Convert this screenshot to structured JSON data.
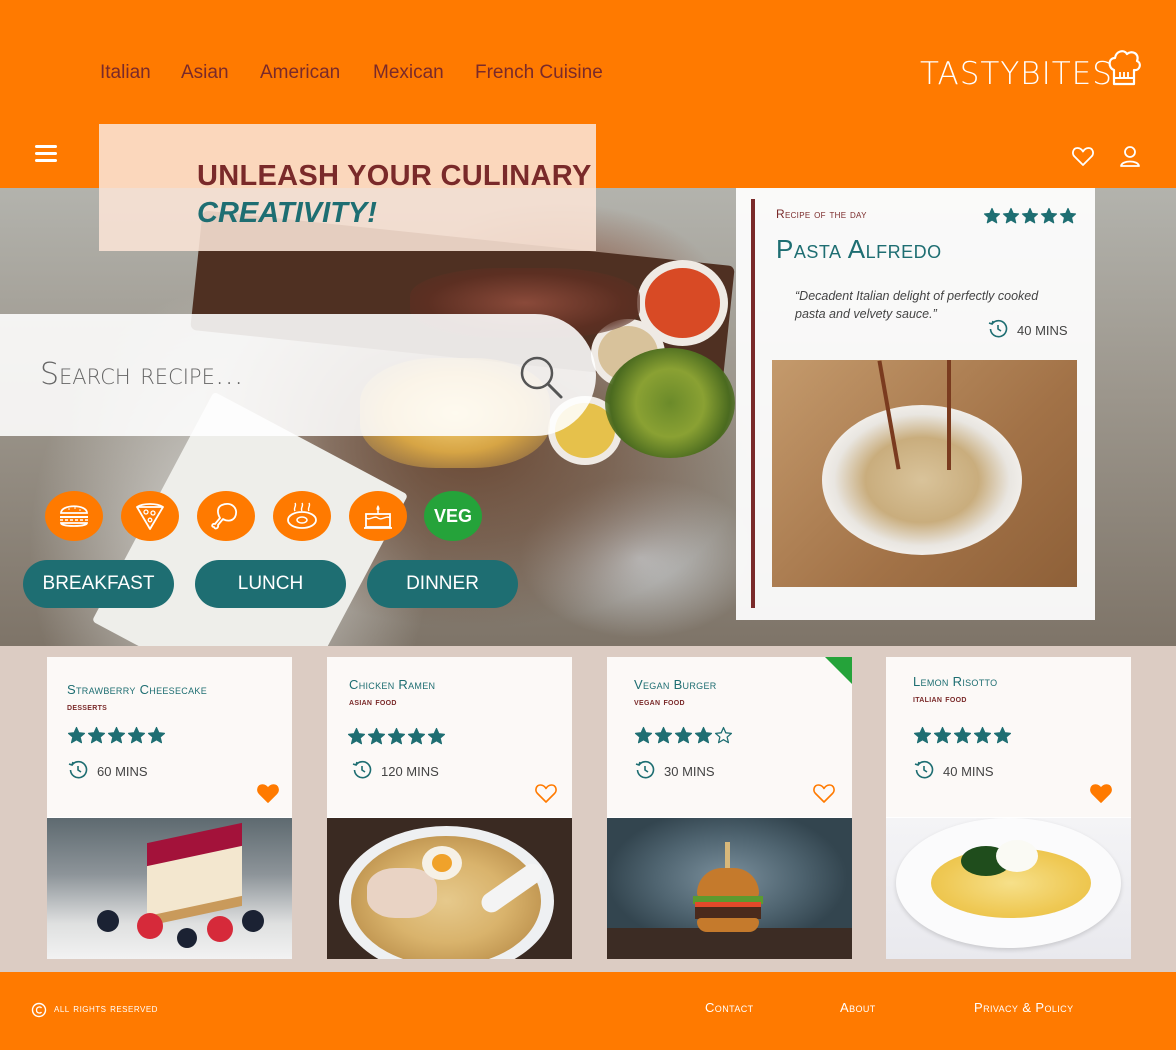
{
  "nav": {
    "links": [
      "Italian",
      "Asian",
      "American",
      "Mexican",
      "French Cuisine"
    ],
    "logo": "TASTYBITES"
  },
  "hero": {
    "headline_line1": "UNLEASH YOUR CULINARY",
    "headline_line2": "CREATIVITY!",
    "search_placeholder": "Search recipe...",
    "veg_label": "VEG",
    "meal_buttons": [
      "BREAKFAST",
      "LUNCH",
      "DINNER"
    ],
    "category_icons": [
      "burger-icon",
      "pizza-icon",
      "chicken-leg-icon",
      "steak-icon",
      "cake-icon"
    ]
  },
  "recipe_of_day": {
    "label": "Recipe of the day",
    "title": "Pasta Alfredo",
    "description": "“Decadent Italian delight of perfectly cooked pasta and velvety sauce.”",
    "time": "40 MINS",
    "rating": 5
  },
  "cards": [
    {
      "title": "Strawberry Cheesecake",
      "category": "desserts",
      "rating": 5,
      "time": "60 MINS",
      "favorite": true
    },
    {
      "title": "Chicken Ramen",
      "category": "asian food",
      "rating": 5,
      "time": "120 MINS",
      "favorite": false
    },
    {
      "title": "Vegan Burger",
      "category": "vegan food",
      "rating": 4,
      "time": "30 MINS",
      "favorite": false
    },
    {
      "title": "Lemon Risotto",
      "category": "italian food",
      "rating": 5,
      "time": "40 MINS",
      "favorite": true
    }
  ],
  "footer": {
    "rights": "all rights reserved",
    "links": [
      "Contact",
      "About",
      "Privacy & Policy"
    ]
  },
  "colors": {
    "brand": "#ff7a00",
    "teal": "#1e6e72",
    "maroon": "#7a2a2a",
    "veg": "#25a33a"
  }
}
